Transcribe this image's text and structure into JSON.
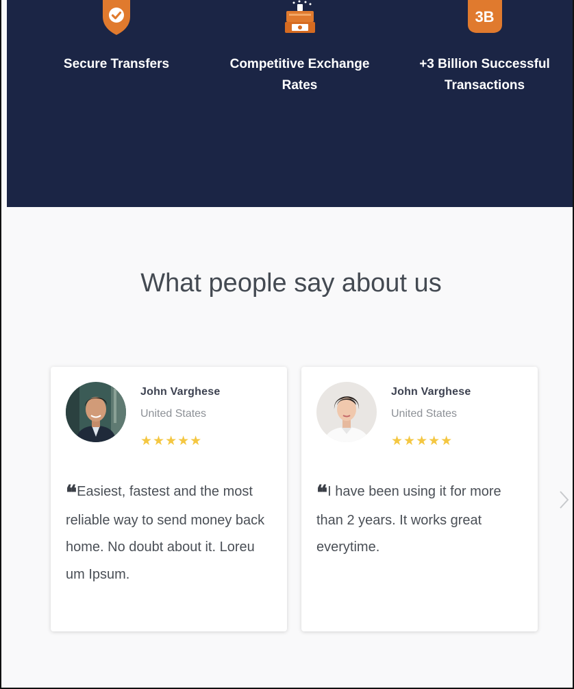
{
  "features": [
    {
      "icon": "shield-check-icon",
      "label_line1": "Secure Transfers",
      "label_line2": ""
    },
    {
      "icon": "cash-register-icon",
      "label_line1": "Competitive Exchange",
      "label_line2": "Rates"
    },
    {
      "icon": "3b-badge-icon",
      "badge_text": "3B",
      "label_line1": "+3 Billion Successful",
      "label_line2": "Transactions"
    }
  ],
  "testimonials": {
    "title": "What people say about us",
    "cards": [
      {
        "name": "John Varghese",
        "country": "United States",
        "stars": "★★★★★",
        "rating": 5,
        "quote": "Easiest, fastest and the most reliable way to send money back home. No doubt about it. Loreu um Ipsum."
      },
      {
        "name": "John Varghese",
        "country": "United States",
        "stars": "★★★★★",
        "rating": 5,
        "quote": "I have been using it for more than 2 years. It works great everytime."
      }
    ]
  },
  "colors": {
    "hero_bg": "#1b2545",
    "accent_orange": "#e07a2e",
    "star": "#f4c742"
  }
}
